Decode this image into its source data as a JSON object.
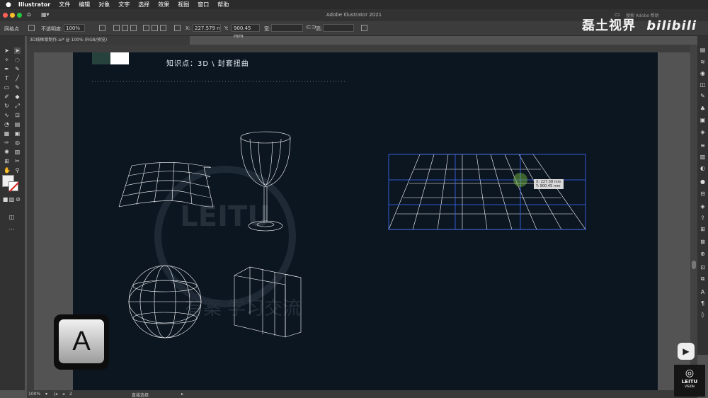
{
  "menubar": {
    "app_name": "Illustrator",
    "items": [
      "文件",
      "编辑",
      "对象",
      "文字",
      "选择",
      "效果",
      "视图",
      "窗口",
      "帮助"
    ]
  },
  "titlebar": {
    "title": "Adobe Illustrator 2021",
    "search_placeholder": "搜索 Adobe 帮助"
  },
  "control_bar": {
    "object_type": "网格点",
    "opacity_label": "不透明度:",
    "opacity_value": "100%",
    "x_label": "X:",
    "x_value": "227.579 n",
    "y_label": "Y:",
    "y_value": "900.45 mm",
    "w_label": "宽:",
    "h_label": "高:"
  },
  "document_tab": {
    "label": "3D线框案制作.ai* @ 100% (RGB/预览)"
  },
  "artboard": {
    "heading": "知识点：3D \\ 封套扭曲",
    "swatches": [
      "#27413d",
      "#ffffff"
    ],
    "watermark_text": "LEITU",
    "watermark_sub": "有案 学习交流"
  },
  "tooltip": {
    "x": "X: 227.58 mm",
    "y": "Y: 900.45 mm"
  },
  "status_bar": {
    "zoom": "100%",
    "artboard_num": "2",
    "tool_label": "直接选择"
  },
  "overlay": {
    "brand": "磊土视界",
    "site_logo": "bilibili",
    "key": "A",
    "corner_logo": "LEITU",
    "corner_sub": "VISION"
  },
  "colors": {
    "artboard_bg": "#0c1621",
    "wire": "#ffffff",
    "selection": "#3b6bff"
  }
}
